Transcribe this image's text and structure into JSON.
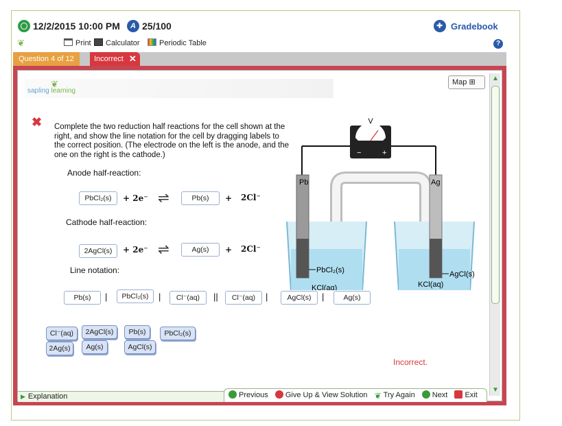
{
  "topbar": {
    "datetime": "12/2/2015 10:00 PM",
    "score": "25/100",
    "gradebook_label": "Gradebook"
  },
  "toolbar": {
    "print_label": "Print",
    "calculator_label": "Calculator",
    "periodic_label": "Periodic Table"
  },
  "question": {
    "tab_label": "Question 4 of 12",
    "status_label": "Incorrect"
  },
  "brand": {
    "logo_a": "sapling",
    "logo_b": "learning"
  },
  "map_label": "Map",
  "prompt": "Complete the two reduction half reactions for the cell shown at the right, and show the line notation for the cell by dragging labels to the correct position.  (The electrode on the left is the anode, and the one on the right is the cathode.)",
  "anode": {
    "heading": "Anode half-reaction:",
    "reactant": "PbCl₂(s)",
    "electrons": "+ 2e⁻",
    "product": "Pb(s)",
    "plus": "+",
    "extra": "2Cl⁻"
  },
  "cathode": {
    "heading": "Cathode half-reaction:",
    "reactant": "2AgCl(s)",
    "electrons": "+ 2e⁻",
    "product": "Ag(s)",
    "plus": "+",
    "extra": "2Cl⁻"
  },
  "line_notation": {
    "heading": "Line notation:",
    "slots": [
      "Pb(s)",
      "PbCl₂(s)",
      "Cl⁻(aq)",
      "Cl⁻(aq)",
      "AgCl(s)",
      "Ag(s)"
    ],
    "single_bar": "|",
    "double_bar": "||"
  },
  "chips": [
    "Cl⁻(aq)",
    "2AgCl(s)",
    "Pb(s)",
    "PbCl₂(s)",
    "2Ag(s)",
    "Ag(s)",
    "AgCl(s)"
  ],
  "diagram": {
    "voltmeter_label": "V",
    "minus": "−",
    "plus": "+",
    "left_electrode": "Pb",
    "right_electrode": "Ag",
    "left_coating": "PbCl₂(s)",
    "right_coating": "AgCl(s)",
    "left_solution": "KCl(aq)",
    "right_solution": "KCl(aq)"
  },
  "feedback": "Incorrect.",
  "bottom": {
    "explanation_label": "Explanation",
    "previous_label": "Previous",
    "giveup_label": "Give Up & View Solution",
    "tryagain_label": "Try Again",
    "next_label": "Next",
    "exit_label": "Exit"
  },
  "colors": {
    "accent_green": "#2e9c47",
    "accent_blue": "#2a5aa8",
    "incorrect_red": "#d7373f",
    "panel_border": "#c74552"
  }
}
